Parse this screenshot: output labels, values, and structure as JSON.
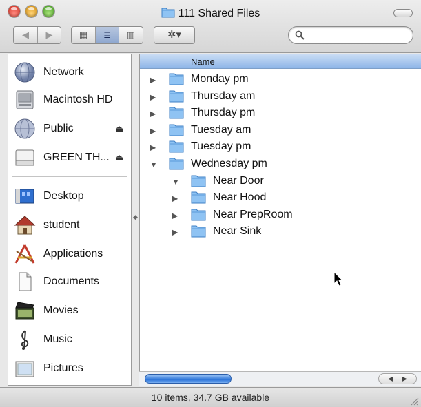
{
  "window": {
    "title": "111 Shared Files"
  },
  "toolbar": {
    "back_glyph": "◀",
    "forward_glyph": "▶",
    "view_icon_glyph": "▦",
    "view_list_glyph": "≣",
    "view_column_glyph": "▥",
    "action_glyph": "✲▾",
    "active_view": "list",
    "search_value": "",
    "search_placeholder": ""
  },
  "sidebar": {
    "devices": [
      {
        "label": "Network",
        "icon": "network-globe-icon"
      },
      {
        "label": "Macintosh HD",
        "icon": "hard-drive-icon"
      },
      {
        "label": "Public",
        "icon": "shared-volume-icon",
        "eject": "⏏"
      },
      {
        "label": "GREEN TH...",
        "icon": "external-drive-icon",
        "eject": "⏏"
      }
    ],
    "places": [
      {
        "label": "Desktop",
        "icon": "desktop-icon"
      },
      {
        "label": "student",
        "icon": "home-icon"
      },
      {
        "label": "Applications",
        "icon": "applications-icon"
      },
      {
        "label": "Documents",
        "icon": "documents-icon"
      },
      {
        "label": "Movies",
        "icon": "movies-icon"
      },
      {
        "label": "Music",
        "icon": "music-icon"
      },
      {
        "label": "Pictures",
        "icon": "pictures-icon"
      }
    ]
  },
  "list": {
    "column_header": "Name",
    "rows": [
      {
        "label": "Monday pm",
        "level": 0,
        "expanded": false
      },
      {
        "label": "Thursday am",
        "level": 0,
        "expanded": false
      },
      {
        "label": "Thursday pm",
        "level": 0,
        "expanded": false
      },
      {
        "label": "Tuesday am",
        "level": 0,
        "expanded": false
      },
      {
        "label": "Tuesday pm",
        "level": 0,
        "expanded": false
      },
      {
        "label": "Wednesday pm",
        "level": 0,
        "expanded": true
      },
      {
        "label": "Near Door",
        "level": 1,
        "expanded": true
      },
      {
        "label": "Near Hood",
        "level": 1,
        "expanded": false
      },
      {
        "label": "Near PrepRoom",
        "level": 1,
        "expanded": false
      },
      {
        "label": "Near Sink",
        "level": 1,
        "expanded": false
      }
    ]
  },
  "scroller": {
    "left_arrow": "◀",
    "right_arrow": "▶"
  },
  "status": {
    "text": "10 items, 34.7 GB available"
  },
  "colors": {
    "folder_blue": "#8fc3f3",
    "header_blue": "#a9c8ef",
    "selection": "#3875d7"
  }
}
